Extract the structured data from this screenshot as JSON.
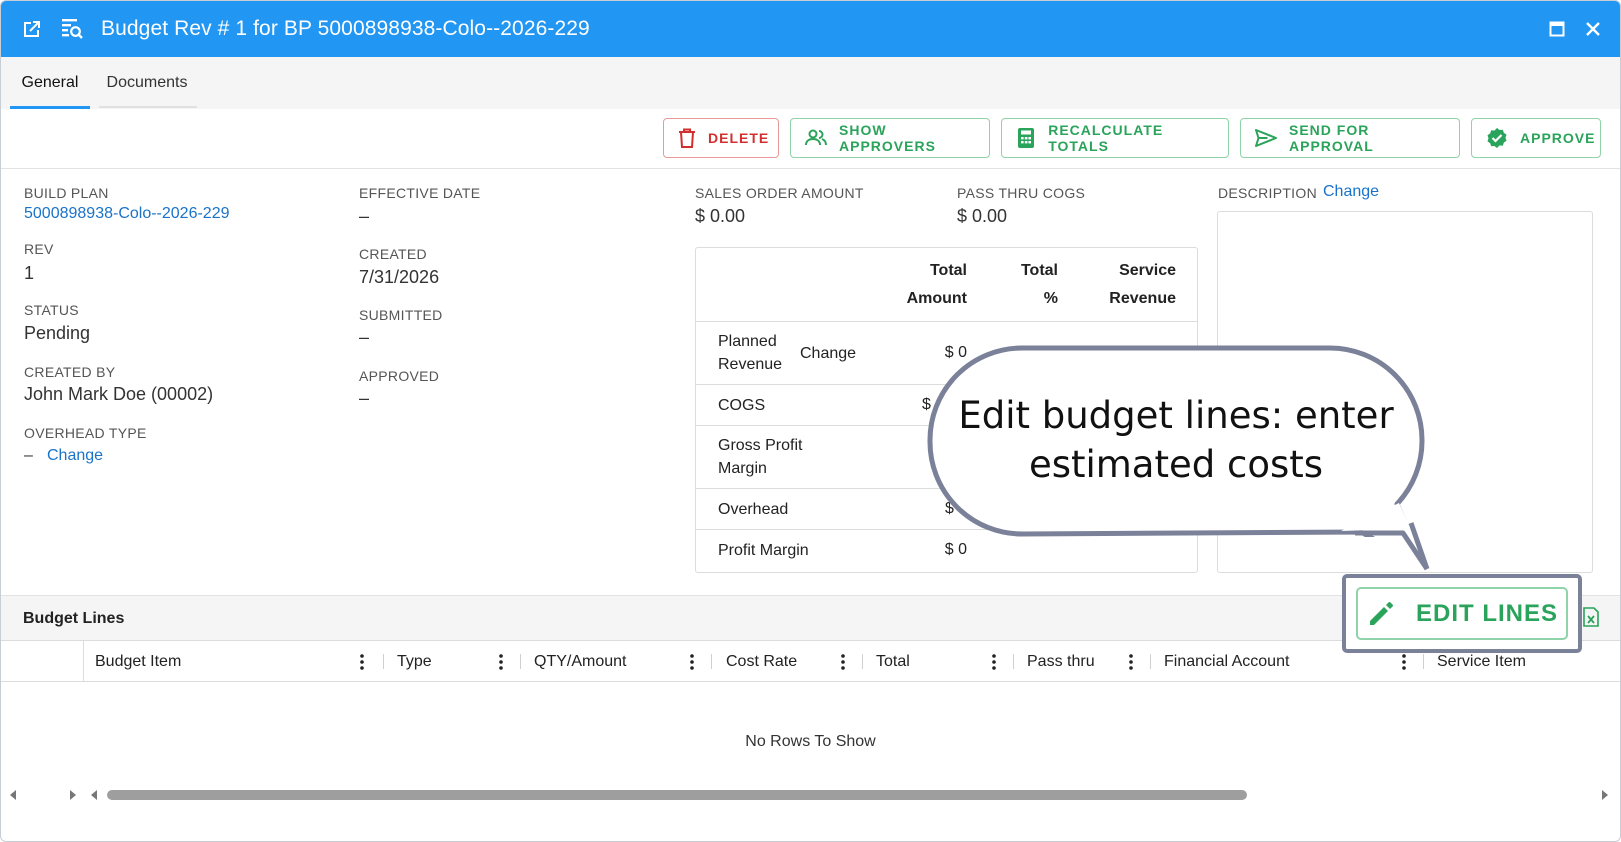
{
  "window": {
    "title": "Budget Rev # 1 for BP 5000898938-Colo--2026-229",
    "icons": [
      "open-external-icon",
      "search-document-icon"
    ],
    "controls": [
      "maximize-icon",
      "close-icon"
    ]
  },
  "tabs": [
    {
      "label": "General",
      "active": true
    },
    {
      "label": "Documents",
      "active": false
    }
  ],
  "toolbar": {
    "delete": "DELETE",
    "show_approvers": "SHOW APPROVERS",
    "recalculate": "RECALCULATE TOTALS",
    "send": "SEND FOR APPROVAL",
    "approve": "APPROVE"
  },
  "info": {
    "build_plan_label": "BUILD PLAN",
    "build_plan_value": "5000898938-Colo--2026-229",
    "rev_label": "REV",
    "rev_value": "1",
    "status_label": "STATUS",
    "status_value": "Pending",
    "created_by_label": "CREATED BY",
    "created_by_value": "John Mark Doe (00002)",
    "overhead_label": "OVERHEAD TYPE",
    "overhead_value": "–",
    "overhead_change": "Change",
    "effective_label": "EFFECTIVE DATE",
    "effective_value": "–",
    "created_label": "CREATED",
    "created_value": "7/31/2026",
    "submitted_label": "SUBMITTED",
    "submitted_value": "–",
    "approved_label": "APPROVED",
    "approved_value": "–",
    "sales_label": "SALES ORDER AMOUNT",
    "sales_value": "$ 0.00",
    "passthru_label": "PASS THRU COGS",
    "passthru_value": "$ 0.00",
    "description_label": "DESCRIPTION",
    "description_change": "Change"
  },
  "summary": {
    "headers": {
      "total_amount_1": "Total",
      "total_amount_2": "Amount",
      "total_pct_1": "Total",
      "total_pct_2": "%",
      "service_rev_1": "Service",
      "service_rev_2": "Revenue"
    },
    "rows": {
      "planned_1": "Planned",
      "planned_2": "Revenue",
      "planned_change": "Change",
      "planned_value": "$ 0",
      "cogs": "COGS",
      "cogs_value": "$",
      "gpm_1": "Gross Profit",
      "gpm_2": "Margin",
      "overhead": "Overhead",
      "overhead_value": "$",
      "profit": "Profit Margin",
      "profit_value": "$ 0"
    }
  },
  "budget_lines": {
    "title": "Budget Lines",
    "columns": [
      "Budget Item",
      "Type",
      "QTY/Amount",
      "Cost Rate",
      "Total",
      "Pass thru",
      "Financial Account",
      "Service Item"
    ],
    "empty_text": "No Rows To Show",
    "edit_lines": "EDIT LINES"
  },
  "callout": {
    "line1": "Edit budget lines: enter",
    "line2": "estimated costs"
  },
  "colors": {
    "titlebar": "#2196f3",
    "accent_green": "#2aa35b",
    "danger_red": "#d32f2f",
    "link_blue": "#1a73c8",
    "callout_border": "#7b8199"
  }
}
